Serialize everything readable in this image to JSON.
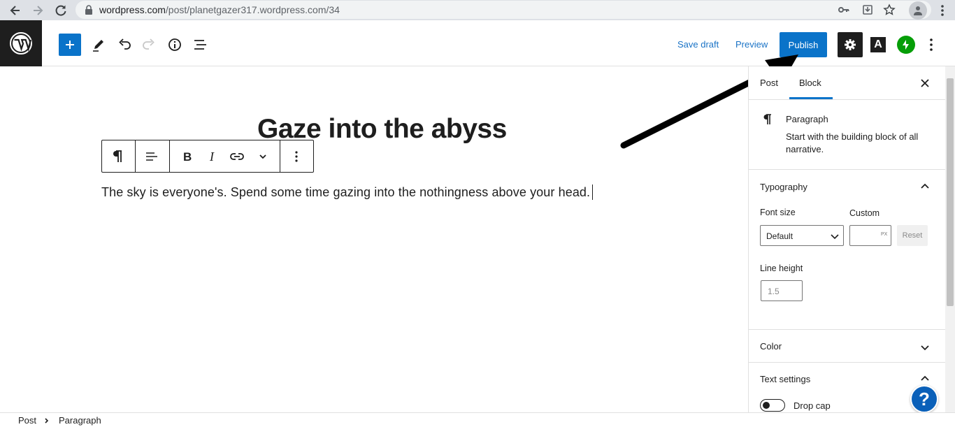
{
  "browser": {
    "url_domain": "wordpress.com",
    "url_path": "/post/planetgazer317.wordpress.com/34"
  },
  "header": {
    "save_draft": "Save draft",
    "preview": "Preview",
    "publish": "Publish",
    "a_button": "A",
    "accent_color": "#0a73c9"
  },
  "editor": {
    "title": "Gaze into the abyss",
    "paragraph": "The sky is everyone's. Spend some time gazing into the nothingness above your head."
  },
  "sidebar": {
    "tabs": [
      "Post",
      "Block"
    ],
    "active_tab": "Block",
    "block_name": "Paragraph",
    "block_desc_line1": "Start with the building block of all",
    "block_desc_line2": "narrative.",
    "typography": "Typography",
    "font_size_label": "Font size",
    "custom_label": "Custom",
    "font_size_value": "Default",
    "custom_unit": "PX",
    "reset": "Reset",
    "line_height_label": "Line height",
    "line_height_placeholder": "1.5",
    "color": "Color",
    "text_settings": "Text settings",
    "drop_cap": "Drop cap"
  },
  "breadcrumb": {
    "items": [
      "Post",
      "Paragraph"
    ]
  },
  "help": {
    "label": "?"
  }
}
